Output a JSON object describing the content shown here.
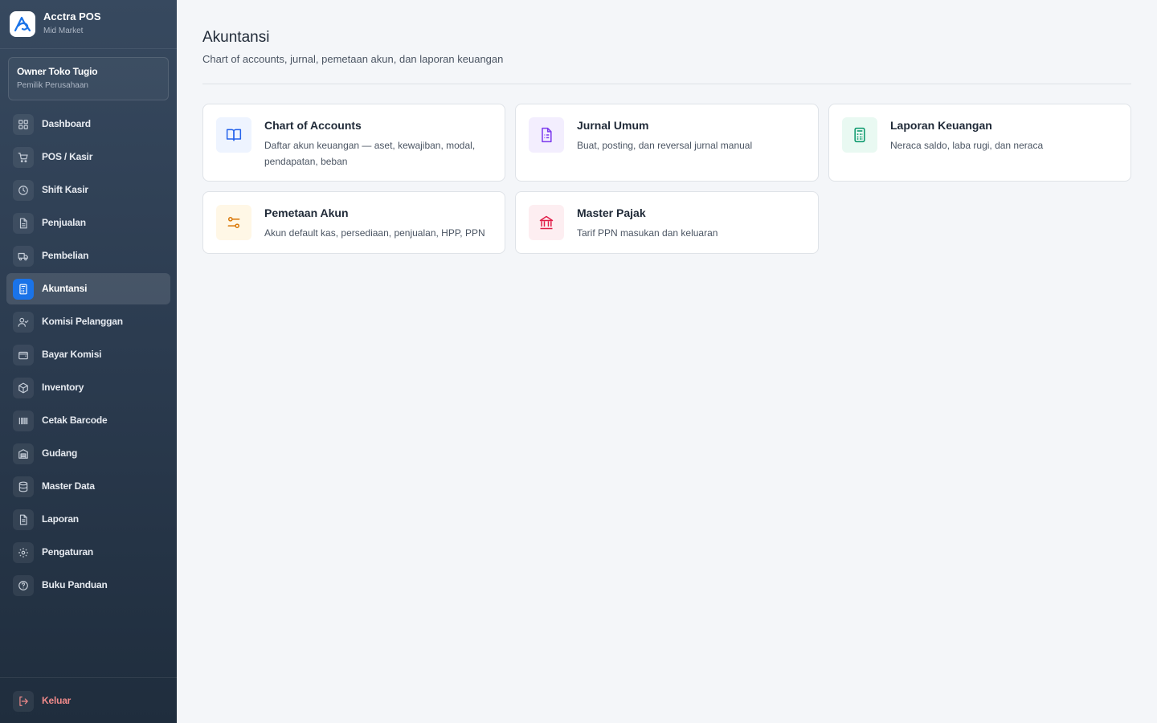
{
  "brand": {
    "name": "Acctra POS",
    "plan": "Mid Market"
  },
  "user": {
    "name": "Owner Toko Tugio",
    "role": "Pemilik Perusahaan"
  },
  "nav": [
    {
      "label": "Dashboard",
      "icon": "dashboard-grid-icon"
    },
    {
      "label": "POS / Kasir",
      "icon": "cart-icon"
    },
    {
      "label": "Shift Kasir",
      "icon": "clock-icon"
    },
    {
      "label": "Penjualan",
      "icon": "document-icon"
    },
    {
      "label": "Pembelian",
      "icon": "truck-icon"
    },
    {
      "label": "Akuntansi",
      "icon": "calculator-icon",
      "active": true
    },
    {
      "label": "Komisi Pelanggan",
      "icon": "user-check-icon"
    },
    {
      "label": "Bayar Komisi",
      "icon": "wallet-icon"
    },
    {
      "label": "Inventory",
      "icon": "box-icon"
    },
    {
      "label": "Cetak Barcode",
      "icon": "barcode-icon"
    },
    {
      "label": "Gudang",
      "icon": "warehouse-icon"
    },
    {
      "label": "Master Data",
      "icon": "database-icon"
    },
    {
      "label": "Laporan",
      "icon": "report-icon"
    },
    {
      "label": "Pengaturan",
      "icon": "gear-icon"
    },
    {
      "label": "Buku Panduan",
      "icon": "help-circle-icon"
    }
  ],
  "logout": {
    "label": "Keluar",
    "icon": "logout-icon",
    "color": "#f08a8a"
  },
  "page": {
    "title": "Akuntansi",
    "subtitle": "Chart of accounts, jurnal, pemetaan akun, dan laporan keuangan"
  },
  "cards": [
    {
      "title": "Chart of Accounts",
      "desc": "Daftar akun keuangan — aset, kewajiban, modal, pendapatan, beban",
      "icon": "open-book-icon",
      "color": "#2563eb",
      "bg": "#eef4ff"
    },
    {
      "title": "Jurnal Umum",
      "desc": "Buat, posting, dan reversal jurnal manual",
      "icon": "file-list-icon",
      "color": "#7c3aed",
      "bg": "#f3eefe"
    },
    {
      "title": "Laporan Keuangan",
      "desc": "Neraca saldo, laba rugi, dan neraca",
      "icon": "calculator-icon",
      "color": "#059669",
      "bg": "#e9f9f2"
    },
    {
      "title": "Pemetaan Akun",
      "desc": "Akun default kas, persediaan, penjualan, HPP, PPN",
      "icon": "sliders-icon",
      "color": "#d97706",
      "bg": "#fff7e6"
    },
    {
      "title": "Master Pajak",
      "desc": "Tarif PPN masukan dan keluaran",
      "icon": "bank-icon",
      "color": "#e11d48",
      "bg": "#fdeef1"
    }
  ],
  "colors": {
    "accent": "#1a73e8",
    "sidebar_top": "#37495f",
    "sidebar_bottom": "#1f2d3d",
    "background": "#f4f6f9"
  }
}
